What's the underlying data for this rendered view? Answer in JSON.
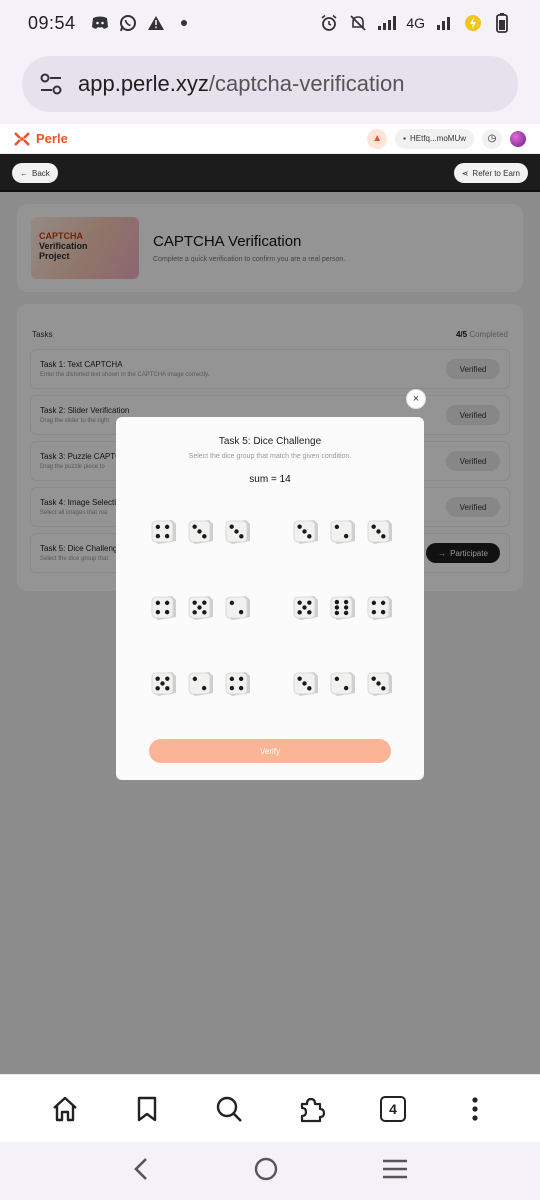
{
  "status_bar": {
    "time": "09:54",
    "network": "4G"
  },
  "browser": {
    "url_host": "app.perle.xyz",
    "url_path": "/captcha-verification",
    "tab_count": "4"
  },
  "site": {
    "brand": "Perle",
    "wallet": "HEtfq...moMUw",
    "back_label": "Back",
    "refer_label": "Refer to Earn"
  },
  "project": {
    "thumb_line1": "CAPTCHA",
    "thumb_line2": "Verification",
    "thumb_line3": "Project",
    "title": "CAPTCHA Verification",
    "subtitle": "Complete a quick verification to confirm you are a real person."
  },
  "tasks": {
    "heading": "Tasks",
    "done": "4/5",
    "done_suffix": "Completed",
    "items": [
      {
        "title": "Task 1: Text CAPTCHA",
        "desc": "Enter the distorted text shown in the CAPTCHA image correctly.",
        "status": "Verified"
      },
      {
        "title": "Task 2: Slider Verification",
        "desc": "Drag the slider to the right",
        "status": "Verified"
      },
      {
        "title": "Task 3: Puzzle CAPTCHA",
        "desc": "Drag the puzzle piece to",
        "status": "Verified"
      },
      {
        "title": "Task 4: Image Selection",
        "desc": "Select all images that ma",
        "status": "Verified"
      },
      {
        "title": "Task 5: Dice Challenge",
        "desc": "Select the dice group that",
        "status": "Participate"
      }
    ]
  },
  "modal": {
    "close": "×",
    "title": "Task 5: Dice Challenge",
    "subtitle": "Select the dice group that match the given condition.",
    "condition": "sum = 14",
    "verify_label": "Verify",
    "dice_groups": [
      [
        4,
        3,
        3
      ],
      [
        3,
        2,
        3
      ],
      [
        4,
        5,
        2
      ],
      [
        5,
        6,
        4
      ],
      [
        5,
        2,
        4
      ],
      [
        3,
        2,
        3
      ]
    ]
  }
}
